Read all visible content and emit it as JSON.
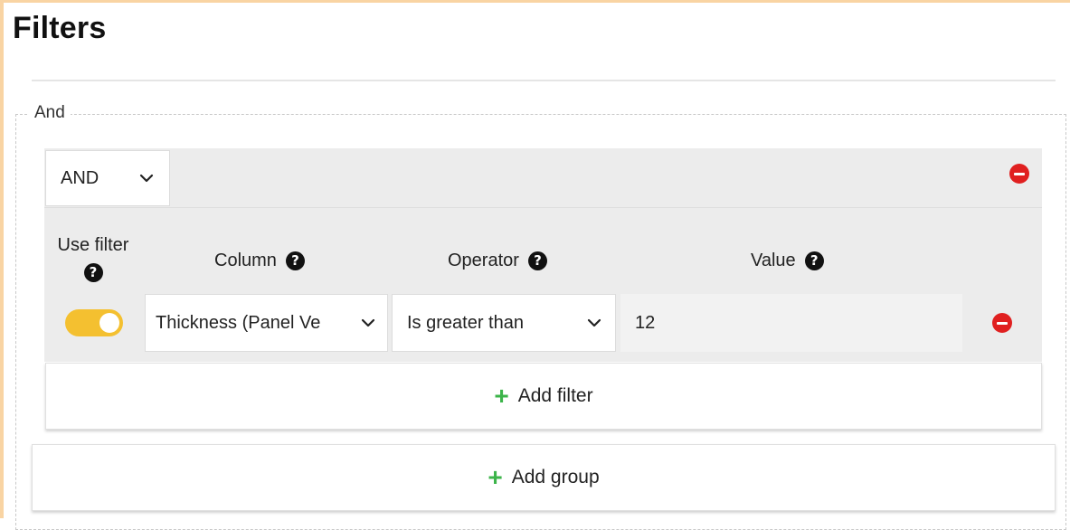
{
  "page": {
    "title": "Filters"
  },
  "root_group": {
    "legend": "And"
  },
  "group": {
    "logic_select": {
      "value": "AND"
    },
    "columns": {
      "use_filter": "Use filter",
      "column": "Column",
      "operator": "Operator",
      "value": "Value"
    },
    "filter_row": {
      "enabled": true,
      "column_value": "Thickness (Panel Ve",
      "operator_value": "Is greater than",
      "value": "12"
    },
    "add_filter_label": "Add filter"
  },
  "add_group_label": "Add group",
  "icons": {
    "help": "help-circle-icon",
    "chevron": "chevron-down-icon",
    "remove": "remove-circle-icon",
    "plus": "plus-icon"
  },
  "colors": {
    "toggle_on": "#f4c030",
    "remove": "#e02020",
    "plus": "#3cb44a",
    "frame_accent": "#f9d4a3"
  }
}
